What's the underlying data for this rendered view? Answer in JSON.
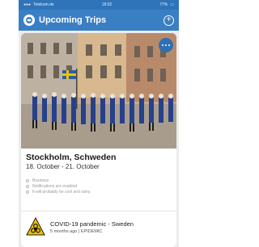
{
  "status_bar": {
    "carrier": "Telekom.de",
    "time": "18:02",
    "battery": "77%"
  },
  "header": {
    "title": "Upcoming Trips",
    "add_icon": "plus-circle-icon"
  },
  "trip": {
    "city": "Stockholm, Schweden",
    "dates": "18. October - 21. October",
    "notes": [
      {
        "icon": "briefcase-icon",
        "text": "Business"
      },
      {
        "icon": "bell-icon",
        "text": "Notifications are enabled"
      },
      {
        "icon": "cloud-icon",
        "text": "It will probably be cool and rainy."
      }
    ]
  },
  "alert": {
    "title": "COVID-19 pandemic - Sweden",
    "subtitle": "5 months ago | EPIDEMIC",
    "icon": "biohazard-icon",
    "color": "#f2c200"
  },
  "colors": {
    "accent": "#3a7fc4",
    "status_bar": "#2f73b8"
  }
}
